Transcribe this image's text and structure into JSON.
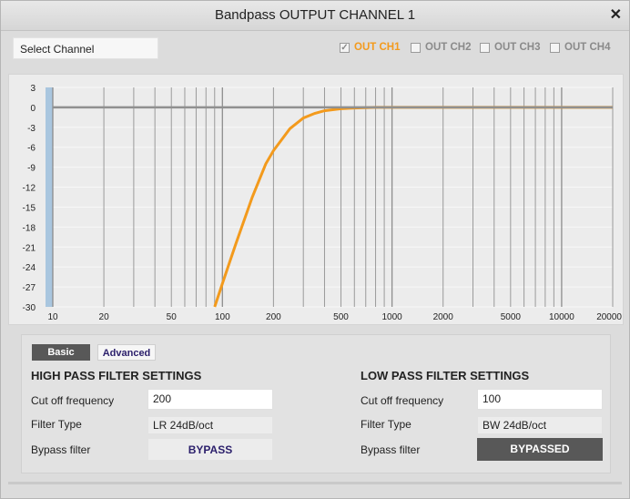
{
  "window": {
    "title": "Bandpass OUTPUT CHANNEL 1",
    "close_glyph": "✕"
  },
  "channel_select": {
    "value": "Select Channel"
  },
  "channels": [
    {
      "label": "OUT CH1",
      "checked": true
    },
    {
      "label": "OUT CH2",
      "checked": false
    },
    {
      "label": "OUT CH3",
      "checked": false
    },
    {
      "label": "OUT CH4",
      "checked": false
    }
  ],
  "colors": {
    "accent": "#f39a1c",
    "dark_button": "#585858",
    "tab_text": "#2b1f6b"
  },
  "chart_data": {
    "type": "line",
    "xscale": "log",
    "xlim": [
      10,
      20000
    ],
    "ylim": [
      -30,
      3
    ],
    "x_ticks": [
      "10",
      "20",
      "50",
      "100",
      "200",
      "500",
      "1000",
      "2000",
      "5000",
      "10000",
      "20000"
    ],
    "y_ticks": [
      "3",
      "0",
      "-3",
      "-6",
      "-9",
      "-12",
      "-15",
      "-18",
      "-21",
      "-24",
      "-27",
      "-30"
    ],
    "grid": true,
    "series": [
      {
        "color": "#f39a1c",
        "x": [
          90,
          100,
          120,
          150,
          180,
          200,
          250,
          300,
          350,
          400,
          500,
          600,
          800,
          1000,
          2000,
          5000,
          10000,
          20000
        ],
        "y": [
          -30,
          -26.5,
          -20.5,
          -13.5,
          -8.5,
          -6.5,
          -3.2,
          -1.6,
          -0.9,
          -0.5,
          -0.2,
          -0.1,
          0,
          0,
          0,
          0,
          0,
          0
        ]
      },
      {
        "color": "#909090",
        "x": [
          10,
          20000
        ],
        "y": [
          0,
          0
        ]
      }
    ]
  },
  "tabs": {
    "basic": "Basic",
    "advanced": "Advanced"
  },
  "hp": {
    "title": "HIGH PASS FILTER SETTINGS",
    "cutoff_label": "Cut off frequency",
    "cutoff_value": "200",
    "type_label": "Filter Type",
    "type_value": "LR 24dB/oct",
    "bypass_label": "Bypass filter",
    "bypass_button": "BYPASS"
  },
  "lp": {
    "title": "LOW PASS FILTER SETTINGS",
    "cutoff_label": "Cut off frequency",
    "cutoff_value": "100",
    "type_label": "Filter Type",
    "type_value": "BW 24dB/oct",
    "bypass_label": "Bypass filter",
    "bypass_button": "BYPASSED"
  }
}
